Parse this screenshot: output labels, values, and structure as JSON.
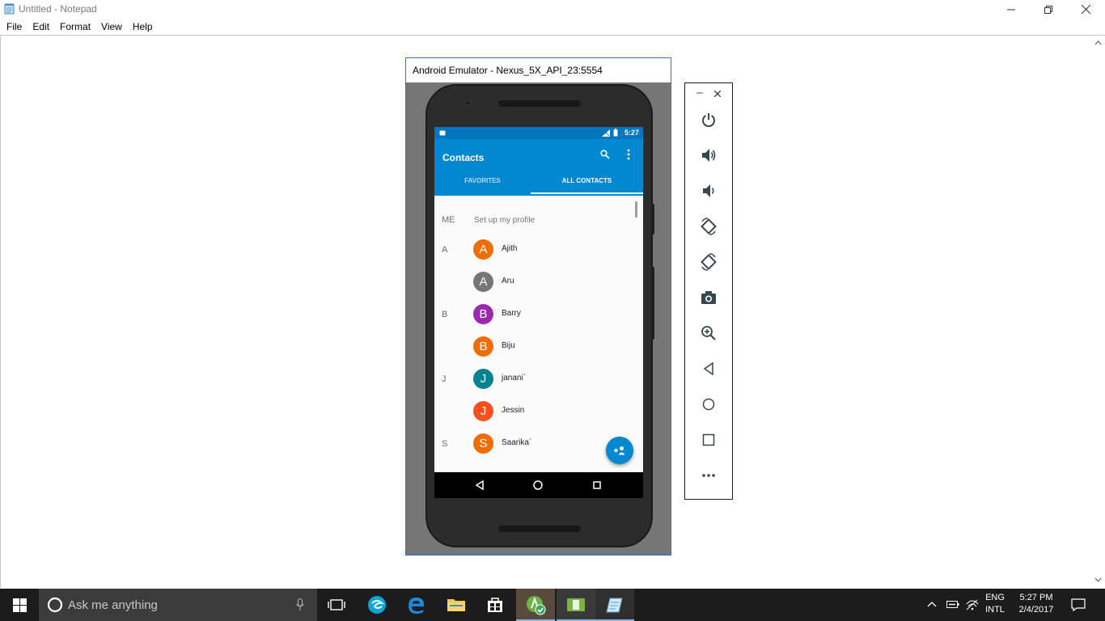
{
  "notepad": {
    "title": "Untitled - Notepad",
    "menu": [
      "File",
      "Edit",
      "Format",
      "View",
      "Help"
    ]
  },
  "emulator": {
    "window_title": "Android Emulator - Nexus_5X_API_23:5554",
    "status_time": "5:27",
    "app_title": "Contacts",
    "tabs": [
      "FAVORITES",
      "ALL CONTACTS"
    ],
    "active_tab": "ALL CONTACTS",
    "me": {
      "label": "ME",
      "text": "Set up my profile"
    },
    "contacts": [
      {
        "section": "A",
        "initial": "A",
        "name": "Ajith",
        "color": "#ef6c00"
      },
      {
        "section": "",
        "initial": "A",
        "name": "Aru",
        "color": "#757575"
      },
      {
        "section": "B",
        "initial": "B",
        "name": "Barry",
        "color": "#9c27b0"
      },
      {
        "section": "",
        "initial": "B",
        "name": "Biju",
        "color": "#ef6c00"
      },
      {
        "section": "J",
        "initial": "J",
        "name": "janani`",
        "color": "#00838f"
      },
      {
        "section": "",
        "initial": "J",
        "name": "Jessin",
        "color": "#f4511e"
      },
      {
        "section": "S",
        "initial": "S",
        "name": "Saarika`",
        "color": "#ef6c00"
      }
    ],
    "accent": "#0288d1"
  },
  "toolbar": {
    "buttons": [
      "power-icon",
      "volume-up-icon",
      "volume-down-icon",
      "rotate-left-icon",
      "rotate-right-icon",
      "camera-icon",
      "zoom-icon",
      "back-icon",
      "home-icon",
      "overview-icon",
      "more-icon"
    ]
  },
  "taskbar": {
    "search_placeholder": "Ask me anything",
    "lang_top": "ENG",
    "lang_bottom": "INTL",
    "time": "5:27 PM",
    "date": "2/4/2017"
  }
}
